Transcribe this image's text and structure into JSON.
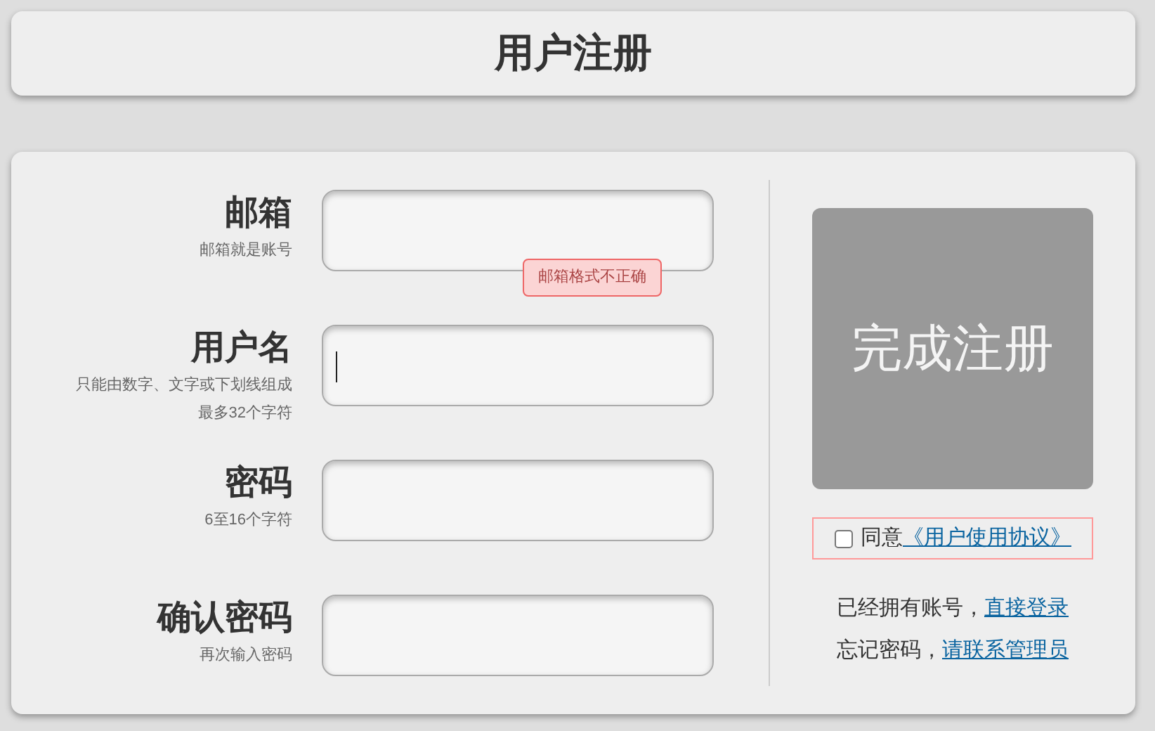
{
  "header": {
    "title": "用户注册"
  },
  "fields": [
    {
      "label": "邮箱",
      "hints": [
        "邮箱就是账号"
      ],
      "focused": false,
      "error": "邮箱格式不正确"
    },
    {
      "label": "用户名",
      "hints": [
        "只能由数字、文字或下划线组成",
        "最多32个字符"
      ],
      "focused": true
    },
    {
      "label": "密码",
      "hints": [
        "6至16个字符"
      ],
      "focused": false
    },
    {
      "label": "确认密码",
      "hints": [
        "再次输入密码"
      ],
      "focused": false
    }
  ],
  "submit": {
    "label": "完成注册"
  },
  "agreement": {
    "checked": false,
    "text": "同意",
    "link": "《用户使用协议》"
  },
  "footer_lines": [
    {
      "text": "已经拥有账号，",
      "link": "直接登录"
    },
    {
      "text": "忘记密码，",
      "link": "请联系管理员"
    }
  ]
}
